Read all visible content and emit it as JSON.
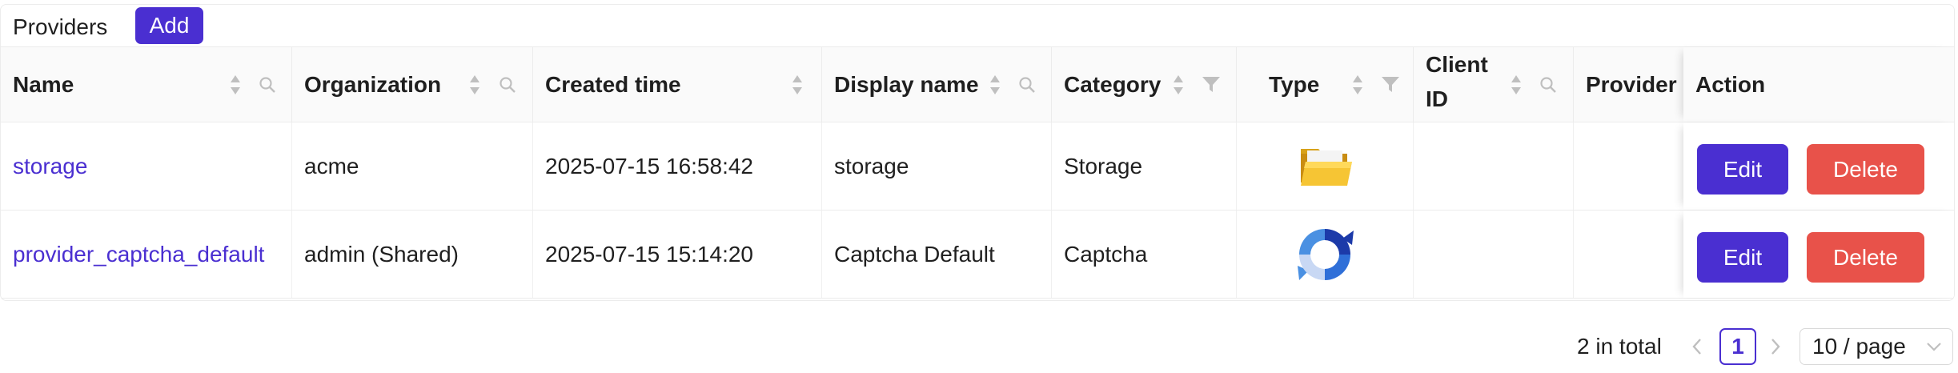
{
  "header": {
    "title": "Providers",
    "add_label": "Add"
  },
  "table": {
    "columns": [
      {
        "key": "name",
        "label": "Name",
        "sort": true,
        "search": true
      },
      {
        "key": "organization",
        "label": "Organization",
        "sort": true,
        "search": true
      },
      {
        "key": "created_time",
        "label": "Created time",
        "sort": true
      },
      {
        "key": "display_name",
        "label": "Display name",
        "sort": true,
        "search": true
      },
      {
        "key": "category",
        "label": "Category",
        "sort": true,
        "filter": true
      },
      {
        "key": "type",
        "label": "Type",
        "sort": true,
        "filter": true
      },
      {
        "key": "client_id",
        "label": "Client ID",
        "sort": true,
        "search": true
      },
      {
        "key": "provider_url",
        "label": "Provider",
        "sort": false
      },
      {
        "key": "action",
        "label": "Action"
      }
    ],
    "rows": [
      {
        "name": "storage",
        "organization": "acme",
        "created_time": "2025-07-15 16:58:42",
        "display_name": "storage",
        "category": "Storage",
        "type_icon": "folder-icon",
        "client_id": "",
        "provider_url": "",
        "edit_label": "Edit",
        "delete_label": "Delete"
      },
      {
        "name": "provider_captcha_default",
        "organization": "admin (Shared)",
        "created_time": "2025-07-15 15:14:20",
        "display_name": "Captcha Default",
        "category": "Captcha",
        "type_icon": "recaptcha-icon",
        "client_id": "",
        "provider_url": "",
        "edit_label": "Edit",
        "delete_label": "Delete"
      }
    ]
  },
  "pagination": {
    "total_text": "2 in total",
    "current_page": "1",
    "page_size": "10 / page"
  },
  "colors": {
    "accent": "#4a2fd1",
    "danger": "#e8524a",
    "header_bg": "#fafafa"
  }
}
